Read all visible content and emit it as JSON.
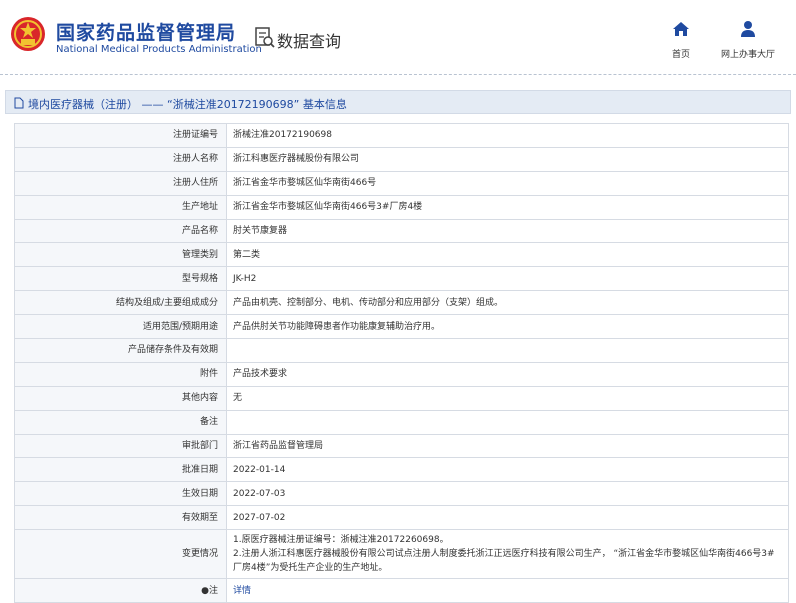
{
  "header": {
    "brand_cn": "国家药品监督管理局",
    "brand_en": "National Medical Products Administration",
    "query_label": "数据查询",
    "nav": [
      {
        "label": "首页",
        "icon": "home-icon"
      },
      {
        "label": "网上办事大厅",
        "icon": "user-icon"
      }
    ]
  },
  "colors": {
    "brand": "#1f4aa0",
    "title_bg": "#e4ebf4",
    "label_bg": "#f5f7fa",
    "border": "#d6dbe3"
  },
  "title": "境内医疗器械（注册） —— “浙械注准20172190698” 基本信息",
  "rows": [
    {
      "label": "注册证编号",
      "value": "浙械注准20172190698"
    },
    {
      "label": "注册人名称",
      "value": "浙江科惠医疗器械股份有限公司"
    },
    {
      "label": "注册人住所",
      "value": "浙江省金华市婺城区仙华南街466号"
    },
    {
      "label": "生产地址",
      "value": "浙江省金华市婺城区仙华南街466号3#厂房4楼"
    },
    {
      "label": "产品名称",
      "value": "肘关节康复器"
    },
    {
      "label": "管理类别",
      "value": "第二类"
    },
    {
      "label": "型号规格",
      "value": "JK-H2"
    },
    {
      "label": "结构及组成/主要组成成分",
      "value": "产品由机壳、控制部分、电机、传动部分和应用部分（支架）组成。"
    },
    {
      "label": "适用范围/预期用途",
      "value": "产品供肘关节功能障碍患者作功能康复辅助治疗用。"
    },
    {
      "label": "产品储存条件及有效期",
      "value": ""
    },
    {
      "label": "附件",
      "value": "产品技术要求"
    },
    {
      "label": "其他内容",
      "value": "无"
    },
    {
      "label": "备注",
      "value": ""
    },
    {
      "label": "审批部门",
      "value": "浙江省药品监督管理局"
    },
    {
      "label": "批准日期",
      "value": "2022-01-14"
    },
    {
      "label": "生效日期",
      "value": "2022-07-03"
    },
    {
      "label": "有效期至",
      "value": "2027-07-02"
    }
  ],
  "change": {
    "label": "变更情况",
    "lines": [
      "1.原医疗器械注册证编号：浙械注准20172260698。",
      "2.注册人浙江科惠医疗器械股份有限公司试点注册人制度委托浙江正远医疗科技有限公司生产， “浙江省金华市婺城区仙华南街466号3#厂房4楼”为受托生产企业的生产地址。"
    ]
  },
  "note": {
    "label": "注",
    "link": "详情"
  }
}
